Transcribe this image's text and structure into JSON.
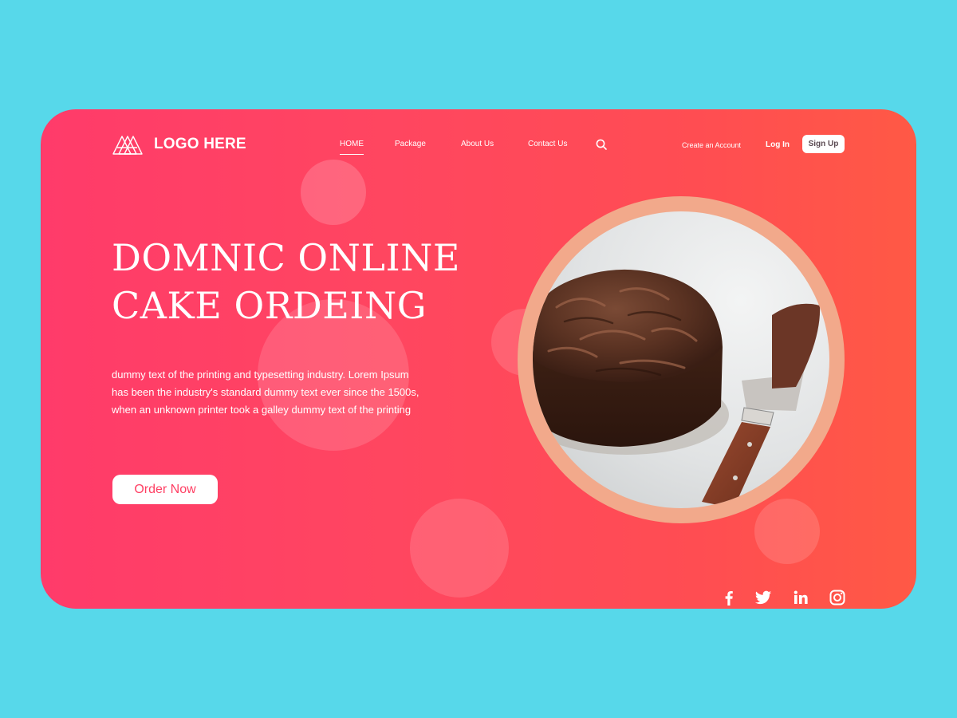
{
  "logo": {
    "text": "LOGO HERE",
    "icon": "mountain-logo-icon"
  },
  "nav": {
    "items": [
      {
        "label": "HOME",
        "active": true
      },
      {
        "label": "Package",
        "active": false
      },
      {
        "label": "About Us",
        "active": false
      },
      {
        "label": "Contact Us",
        "active": false
      }
    ],
    "search_icon": "search-icon"
  },
  "auth": {
    "create_account": "Create an Account",
    "login": "Log In",
    "signup": "Sign Up"
  },
  "hero": {
    "title_line1": "DOMNIC ONLINE",
    "title_line2": "CAKE ORDEING",
    "description_line1": "dummy text of the printing and typesetting industry. Lorem Ipsum",
    "description_line2": "has been the industry's standard dummy text ever since the 1500s,",
    "description_line3": "when an unknown printer took a galley dummy text of the printing",
    "cta": "Order Now",
    "image": "chocolate-cake-photo"
  },
  "social": [
    "facebook-icon",
    "twitter-icon",
    "linkedin-icon",
    "instagram-icon"
  ],
  "colors": {
    "background": "#57d8ea",
    "card_gradient_start": "#ff3b6a",
    "card_gradient_end": "#ff5945",
    "ring": "#f2a98b",
    "cta_text": "#ff3f63"
  }
}
